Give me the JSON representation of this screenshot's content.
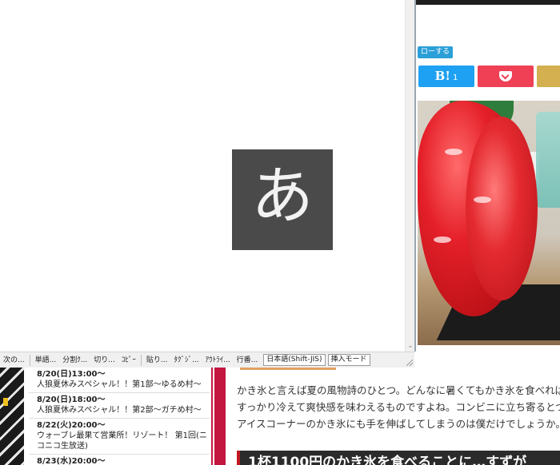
{
  "ime": {
    "char": "あ"
  },
  "status_bar": {
    "commands": [
      "次の...",
      "単語...",
      "分割ｸ...",
      "切り...",
      "ｺﾋﾟｰ",
      "貼り...",
      "ﾀｸﾞｼﾞ...",
      "ｱｳﾄﾗｲ...",
      "行番..."
    ],
    "encoding": "日本語(Shift-JIS)",
    "mode": "挿入モード"
  },
  "browser": {
    "follow_label": "ローする",
    "share": {
      "hatena_label": "B!",
      "hatena_count": "1"
    }
  },
  "schedule": [
    {
      "time": "8/20(日)13:00～",
      "title": "人狼夏休みスペシャル！！第1部～ゆるめ村～"
    },
    {
      "time": "8/20(日)18:00～",
      "title": "人狼夏休みスペシャル！！第2部～ガチめ村～"
    },
    {
      "time": "8/22(火)20:00～",
      "title": "ウォーブレ最果て営業所！リゾート！ 第1回(ニコニコ生放送)"
    },
    {
      "time": "8/23(水)20:00～",
      "title": ""
    }
  ],
  "article": {
    "lines": [
      "かき氷と言えば夏の風物詩のひとつ。どんなに暑くてもかき氷を食べれば",
      "すっかり冷えて爽快感を味わえるものですよね。コンビニに立ち寄るとつ",
      "アイスコーナーのかき氷にも手を伸ばしてしまうのは僕だけでしょうか。"
    ],
    "heading": "1杯1100円のかき氷を食べることに…すずが"
  }
}
